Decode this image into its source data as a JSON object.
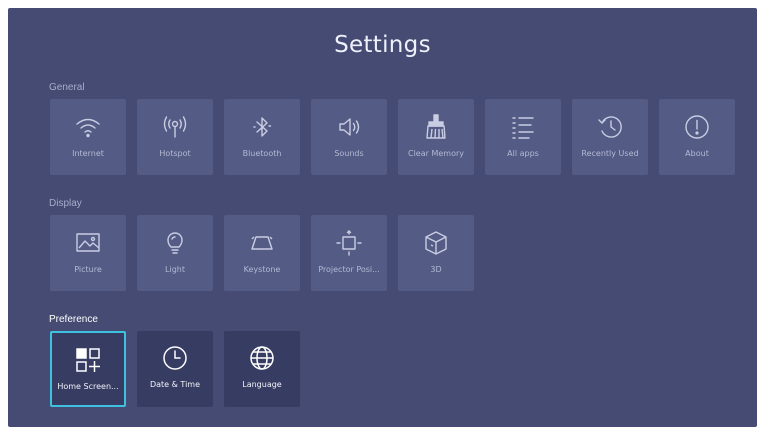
{
  "title": "Settings",
  "sections": {
    "general": {
      "label": "General",
      "items": [
        {
          "label": "Internet",
          "icon": "wifi-icon"
        },
        {
          "label": "Hotspot",
          "icon": "hotspot-icon"
        },
        {
          "label": "Bluetooth",
          "icon": "bluetooth-icon"
        },
        {
          "label": "Sounds",
          "icon": "speaker-icon"
        },
        {
          "label": "Clear Memory",
          "icon": "broom-icon"
        },
        {
          "label": "All apps",
          "icon": "list-icon"
        },
        {
          "label": "Recently Used",
          "icon": "history-icon"
        },
        {
          "label": "About",
          "icon": "info-icon"
        }
      ]
    },
    "display": {
      "label": "Display",
      "items": [
        {
          "label": "Picture",
          "icon": "picture-icon"
        },
        {
          "label": "Light",
          "icon": "bulb-icon"
        },
        {
          "label": "Keystone",
          "icon": "keystone-icon"
        },
        {
          "label": "Projector Posi...",
          "icon": "projector-position-icon"
        },
        {
          "label": "3D",
          "icon": "cube-icon"
        }
      ]
    },
    "preference": {
      "label": "Preference",
      "items": [
        {
          "label": "Home Screen...",
          "icon": "home-screen-icon"
        },
        {
          "label": "Date & Time",
          "icon": "clock-icon"
        },
        {
          "label": "Language",
          "icon": "globe-icon"
        }
      ]
    }
  },
  "colors": {
    "background": "#454b73",
    "tile": "#545b85",
    "tile_pref": "#373c62",
    "focus_border": "#3fc2df"
  }
}
